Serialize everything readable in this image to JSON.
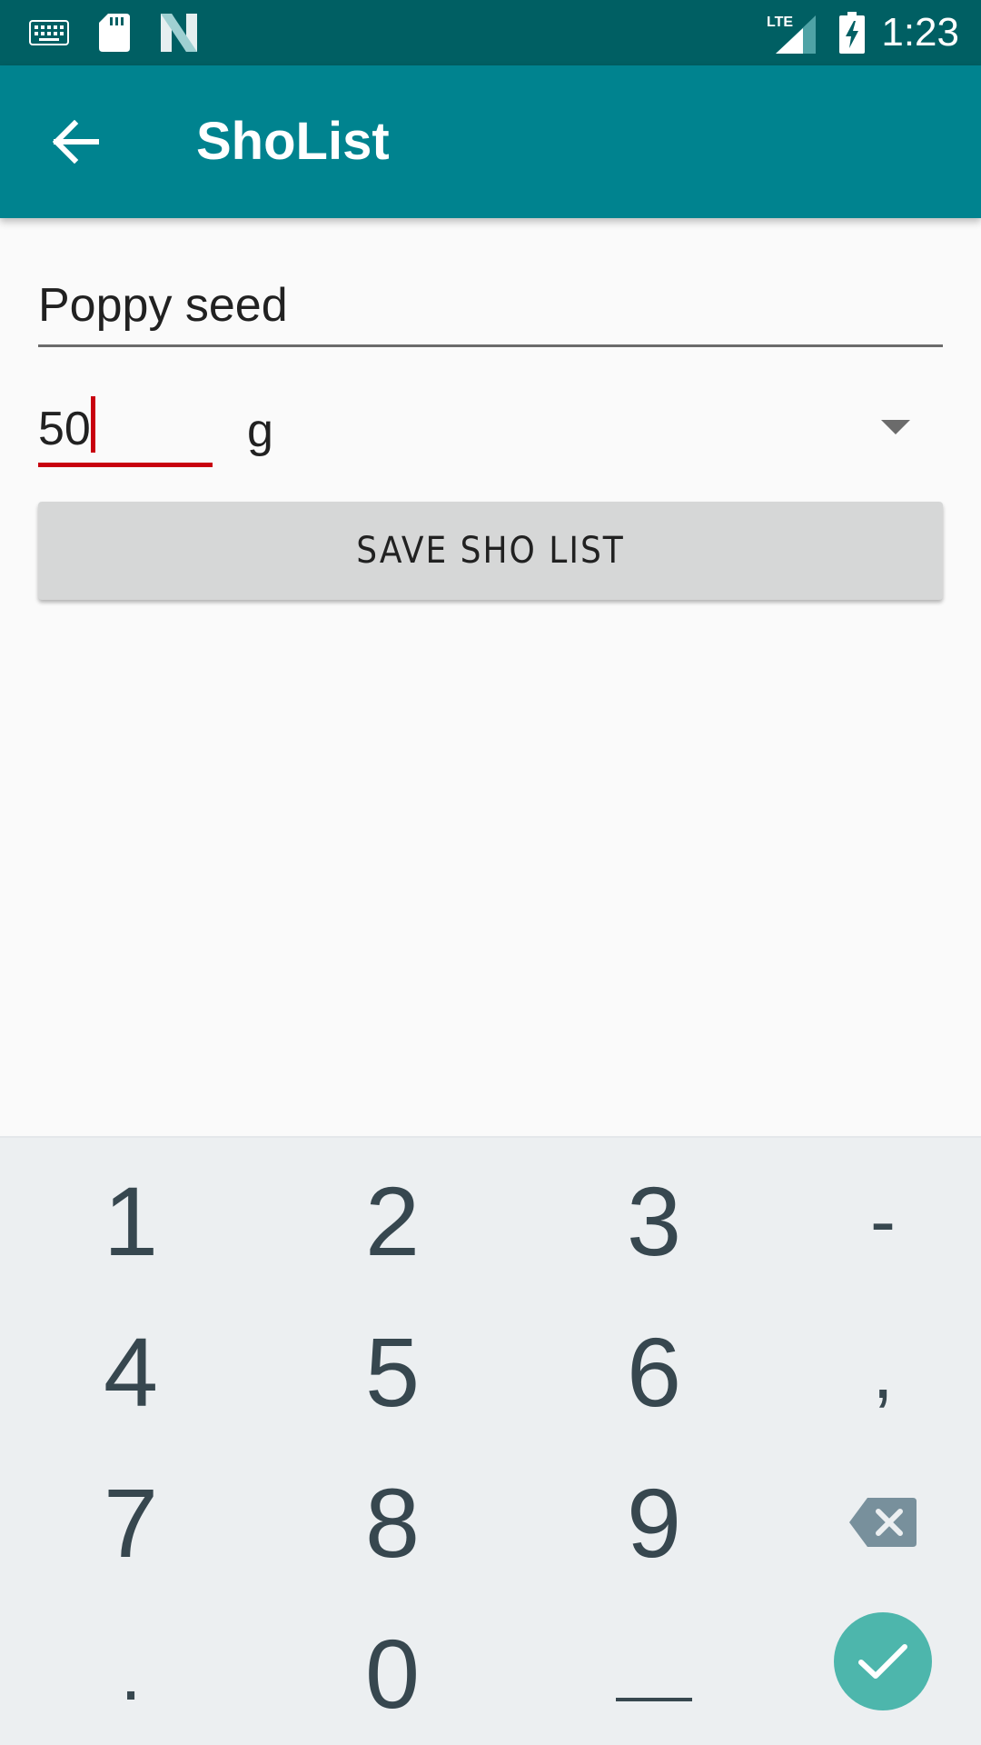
{
  "colors": {
    "status_bar": "#005f63",
    "app_bar": "#00838f",
    "accent": "#c8000f",
    "keyboard_bg": "#eceff1",
    "enter_key": "#4db6ac"
  },
  "status_bar": {
    "icons": [
      "keyboard-icon",
      "sd-card-icon",
      "n-notification-icon",
      "lte-signal-icon",
      "battery-charging-icon"
    ],
    "lte_label": "LTE",
    "time": "1:23"
  },
  "app_bar": {
    "back_icon": "arrow-back-icon",
    "title": "ShoList"
  },
  "form": {
    "item_name": "Poppy seed",
    "quantity": "50",
    "unit": "g",
    "save_button": "SAVE SHO LIST"
  },
  "keyboard": {
    "rows": [
      [
        "1",
        "2",
        "3",
        "-"
      ],
      [
        "4",
        "5",
        "6",
        ","
      ],
      [
        "7",
        "8",
        "9",
        "backspace-icon"
      ],
      [
        ".",
        "0",
        "space-icon",
        "check-icon"
      ]
    ]
  }
}
